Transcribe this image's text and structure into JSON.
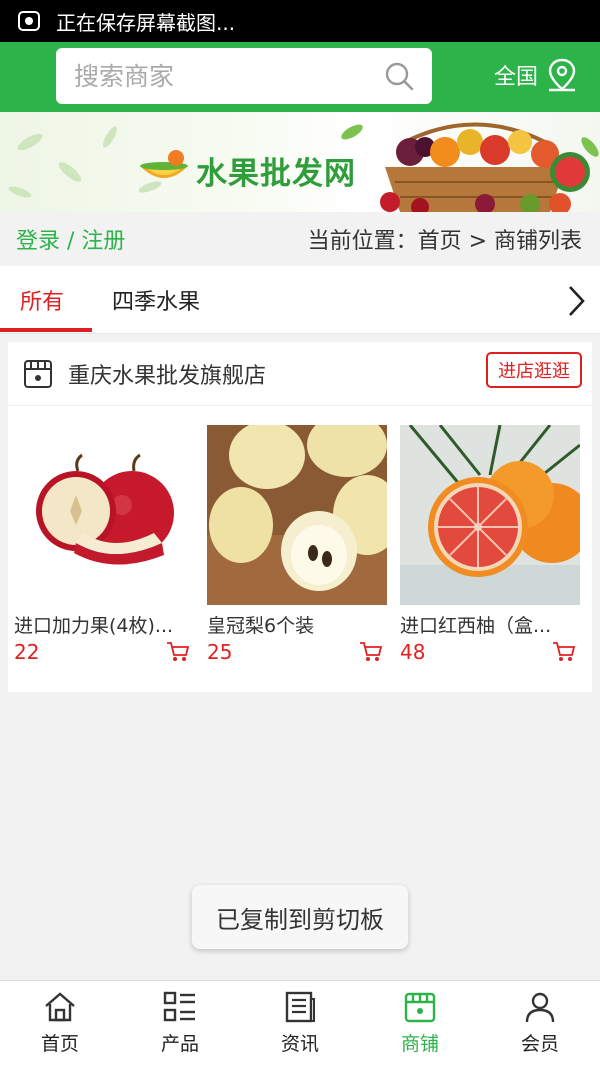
{
  "status_bar": {
    "text": "正在保存屏幕截图..."
  },
  "header": {
    "search_placeholder": "搜索商家",
    "region_label": "全国"
  },
  "banner": {
    "logo_text": "水果批发网"
  },
  "crumbbar": {
    "login_label": "登录 / 注册",
    "location": "当前位置：首页 > 商铺列表"
  },
  "tabs": [
    {
      "label": "所有",
      "active": true
    },
    {
      "label": "四季水果",
      "active": false
    }
  ],
  "shop": {
    "name": "重庆水果批发旗舰店",
    "visit_label": "进店逛逛",
    "products": [
      {
        "name": "进口加力果(4枚)...",
        "price": "22",
        "icon": "apple-image"
      },
      {
        "name": "皇冠梨6个装",
        "price": "25",
        "icon": "pear-image"
      },
      {
        "name": "进口红西柚（盒...",
        "price": "48",
        "icon": "grapefruit-image"
      }
    ]
  },
  "toast": {
    "text": "已复制到剪切板"
  },
  "bottom_nav": [
    {
      "label": "首页",
      "icon": "home-icon",
      "active": false
    },
    {
      "label": "产品",
      "icon": "product-list-icon",
      "active": false
    },
    {
      "label": "资讯",
      "icon": "news-icon",
      "active": false
    },
    {
      "label": "商铺",
      "icon": "shop-icon",
      "active": true
    },
    {
      "label": "会员",
      "icon": "user-icon",
      "active": false
    }
  ],
  "colors": {
    "brand_green": "#2cb34a",
    "accent_red": "#e02020"
  }
}
